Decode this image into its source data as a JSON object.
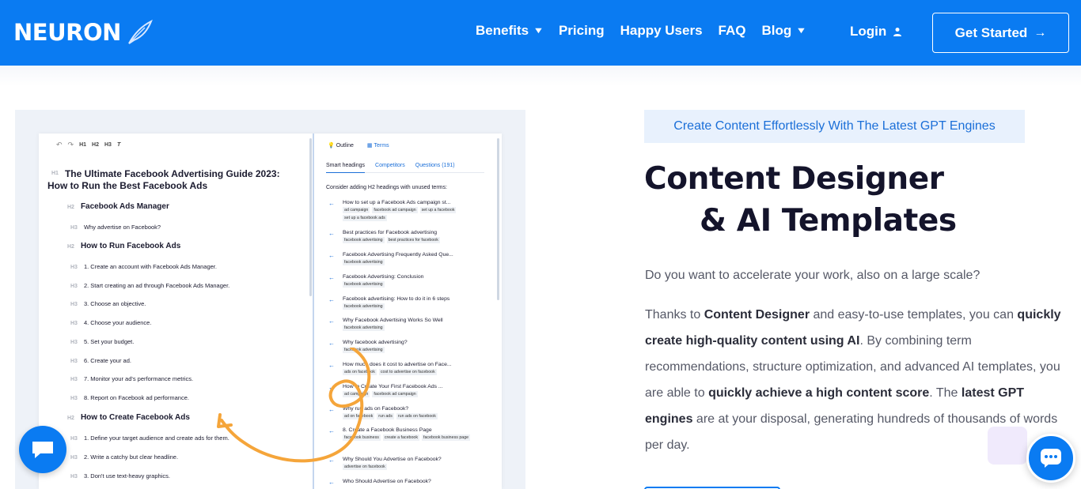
{
  "nav": {
    "logo": "NEURON",
    "menu": [
      {
        "label": "Benefits",
        "dropdown": true
      },
      {
        "label": "Pricing",
        "dropdown": false
      },
      {
        "label": "Happy Users",
        "dropdown": false
      },
      {
        "label": "FAQ",
        "dropdown": false
      },
      {
        "label": "Blog",
        "dropdown": true
      }
    ],
    "login": "Login",
    "cta": "Get Started"
  },
  "editor": {
    "toolbar": [
      "H1",
      "H2",
      "H3",
      "T"
    ],
    "headings": [
      {
        "level": "H1",
        "text": "The Ultimate Facebook Advertising Guide 2023:",
        "text2": "How to Run the Best Facebook Ads"
      },
      {
        "level": "H2",
        "text": "Facebook Ads Manager"
      },
      {
        "level": "H3",
        "text": "Why advertise on Facebook?"
      },
      {
        "level": "H2",
        "text": "How to Run Facebook Ads"
      },
      {
        "level": "H3",
        "text": "1. Create an account with Facebook Ads Manager."
      },
      {
        "level": "H3",
        "text": "2. Start creating an ad through Facebook Ads Manager."
      },
      {
        "level": "H3",
        "text": "3. Choose an objective."
      },
      {
        "level": "H3",
        "text": "4. Choose your audience."
      },
      {
        "level": "H3",
        "text": "5. Set your budget."
      },
      {
        "level": "H3",
        "text": "6. Create your ad."
      },
      {
        "level": "H3",
        "text": "7. Monitor your ad's performance metrics."
      },
      {
        "level": "H3",
        "text": "8. Report on Facebook ad performance."
      },
      {
        "level": "H2",
        "text": "How to Create Facebook Ads"
      },
      {
        "level": "H3",
        "text": "1. Define your target audience and create ads for them."
      },
      {
        "level": "H3",
        "text": "2. Write a catchy but clear headline."
      },
      {
        "level": "H3",
        "text": "3. Don't use text-heavy graphics."
      }
    ]
  },
  "pane": {
    "tabs": [
      "Outline",
      "Terms"
    ],
    "subtabs": [
      "Smart headings",
      "Competitors",
      "Questions (191)"
    ],
    "hint": "Consider adding H2 headings with unused terms:",
    "suggestions": [
      {
        "title": "How to set up a Facebook Ads campaign st...",
        "terms": [
          "ad campaign",
          "facebook ad campaign",
          "set up a facebook",
          "set up a facebook ads"
        ]
      },
      {
        "title": "Best practices for Facebook advertising",
        "terms": [
          "facebook advertising",
          "best practices for facebook"
        ]
      },
      {
        "title": "Facebook Advertising Frequently Asked Que...",
        "terms": [
          "facebook advertising"
        ]
      },
      {
        "title": "Facebook Advertising: Conclusion",
        "terms": [
          "facebook advertising"
        ]
      },
      {
        "title": "Facebook advertising: How to do it in 6 steps",
        "terms": [
          "facebook advertising"
        ]
      },
      {
        "title": "Why Facebook Advertising Works So Well",
        "terms": [
          "facebook advertising"
        ]
      },
      {
        "title": "Why facebook advertising?",
        "terms": [
          "facebook advertising"
        ]
      },
      {
        "title": "How much does it cost to advertise on Face...",
        "terms": [
          "ads on facebook",
          "cost to advertise on facebook"
        ]
      },
      {
        "title": "How to Create Your First Facebook Ads ...",
        "terms": [
          "ad campaign",
          "facebook ad campaign"
        ]
      },
      {
        "title": "Why run ads on Facebook?",
        "terms": [
          "ad on facebook",
          "run ads",
          "run ads on facebook"
        ]
      },
      {
        "title": "8. Create a Facebook Business Page",
        "terms": [
          "facebook business",
          "create a facebook",
          "facebook business page"
        ]
      },
      {
        "title": "Why Should You Advertise on Facebook?",
        "terms": [
          "advertise on facebook"
        ]
      },
      {
        "title": "Who Should Advertise on Facebook?",
        "terms": []
      }
    ]
  },
  "hero": {
    "tag": "Create Content Effortlessly With The Latest GPT Engines",
    "title_line1": "Content Designer",
    "title_line2": "& AI Templates",
    "lead": "Do you want to accelerate your work, also on a large scale?",
    "p": [
      "Thanks to ",
      "Content Designer",
      " and easy-to-use templates, you can ",
      "quickly create high-quality content using AI",
      ". By combining term recommendations, structure optimization, and advanced AI templates, you are able to ",
      "quickly achieve a high content score",
      ". The ",
      "latest GPT engines",
      " are at your disposal, generating hundreds of thousands of words per day."
    ]
  },
  "colors": {
    "brand": "#0a7bf2",
    "accent_orange": "#f5a53a"
  }
}
